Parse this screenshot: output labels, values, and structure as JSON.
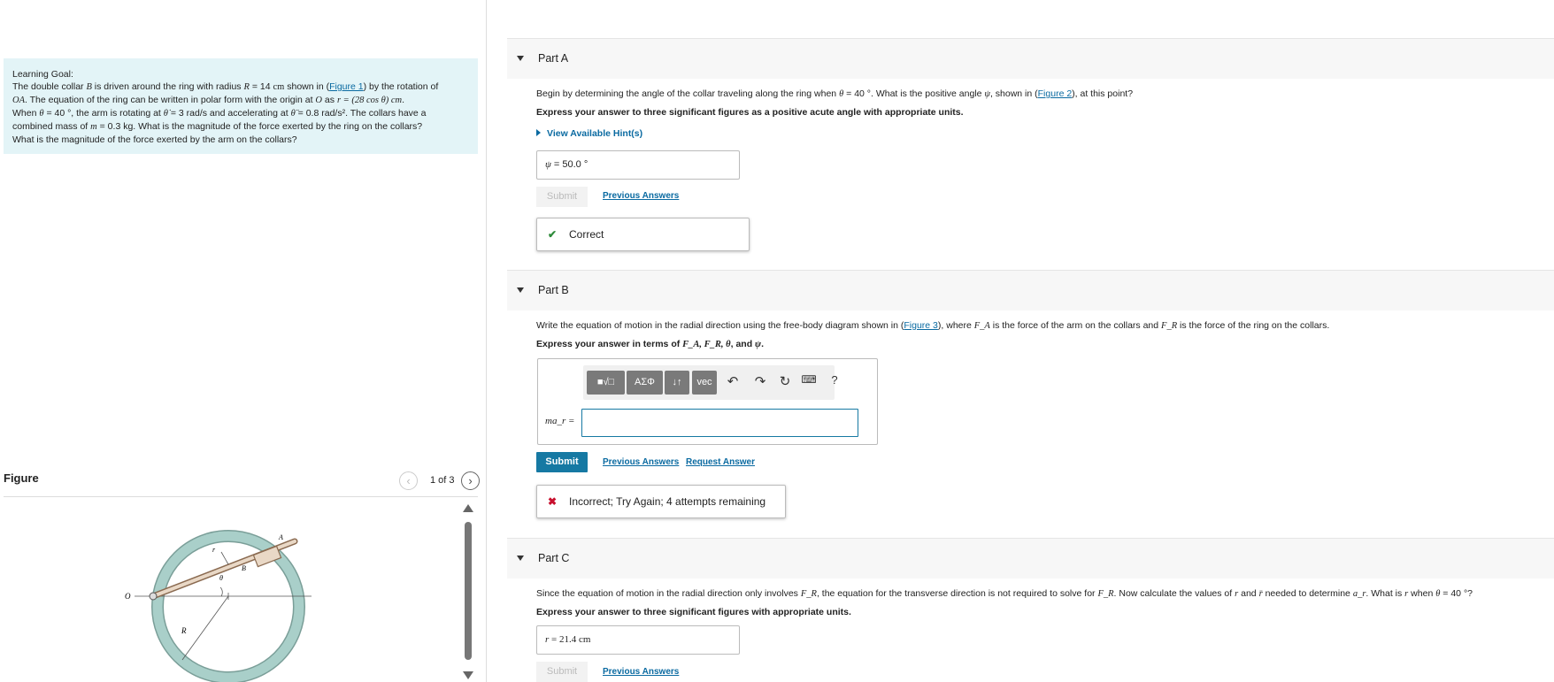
{
  "learning_goal": {
    "title": "Learning Goal:",
    "line1_a": "The double collar ",
    "line1_b": "B",
    "line1_c": " is driven around the ring with radius ",
    "line1_d": "R",
    "line1_e": " = 14 ",
    "line1_f": "cm",
    "line1_g": " shown in (",
    "line1_link": "Figure 1",
    "line1_h": ") by the rotation of",
    "line2_a": "OA",
    "line2_b": ". The equation of the ring can be written in polar form with the origin at ",
    "line2_c": "O",
    "line2_d": " as ",
    "line2_e": "r = (28 cos θ) cm",
    "line2_f": ".",
    "line3_a": "When ",
    "line3_b": "θ",
    "line3_c": " = 40 °, the arm is rotating at ",
    "line3_d": "θ̇",
    "line3_e": " = 3 rad/s and accelerating at ",
    "line3_f": "θ̈",
    "line3_g": " = 0.8 rad/s²",
    "line3_h": ". The collars have a",
    "line4_a": "combined mass of ",
    "line4_b": "m",
    "line4_c": " = 0.3 kg",
    "line4_d": ". What is the magnitude of the force exerted by the ring on the collars?",
    "line5": "What is the magnitude of the force exerted by the arm on the collars?"
  },
  "figure": {
    "title": "Figure",
    "counter": "1 of 3",
    "prev_icon": "chevron-left-icon",
    "next_icon": "chevron-right-icon",
    "labels": {
      "O": "O",
      "A": "A",
      "B": "B",
      "r": "r",
      "theta": "θ",
      "R": "R"
    }
  },
  "part_a": {
    "title": "Part A",
    "question_a": "Begin by determining the angle of the collar traveling along the ring when ",
    "question_b": "θ",
    "question_c": " = 40 °. What is the positive angle ",
    "question_d": "ψ",
    "question_e": ", shown in (",
    "question_link": "Figure 2",
    "question_f": "), at this point?",
    "instruction": "Express your answer to three significant figures as a positive acute angle with appropriate units.",
    "hint_label": "View Available Hint(s)",
    "answer_var": "ψ",
    "answer_value": " =  50.0 °",
    "submit_label": "Submit",
    "previous_answers": "Previous Answers",
    "feedback_mark": "✔",
    "feedback": "Correct"
  },
  "part_b": {
    "title": "Part B",
    "question_a": "Write the equation of motion in the radial direction using the free-body diagram shown in (",
    "question_link": "Figure 3",
    "question_b": "), where ",
    "question_c": "F_A",
    "question_d": " is the force of the arm on the collars and ",
    "question_e": "F_R",
    "question_f": " is the force of the ring on the collars.",
    "instruction_a": "Express your answer in terms of ",
    "instruction_b": "F_A, F_R, θ",
    "instruction_c": ", and ",
    "instruction_d": "ψ",
    "instruction_e": ".",
    "toolbar": {
      "template": "■√□",
      "greek": "ΑΣΦ",
      "arrows": "↓↑",
      "vec": "vec",
      "undo_icon": "undo-icon",
      "redo_icon": "redo-icon",
      "reset_icon": "reset-icon",
      "keyboard_icon": "keyboard-icon",
      "help": "?"
    },
    "input_label": "ma_r =",
    "input_value": "",
    "submit_label": "Submit",
    "previous_answers": "Previous Answers",
    "request_answer": "Request Answer",
    "feedback_mark": "✖",
    "feedback": "Incorrect; Try Again; 4 attempts remaining"
  },
  "part_c": {
    "title": "Part C",
    "question_a": "Since the equation of motion in the radial direction only involves ",
    "question_b": "F_R",
    "question_c": ", the equation for the transverse direction is not required to solve for ",
    "question_d": "F_R",
    "question_e": ". Now calculate the values of ",
    "question_f": "r",
    "question_g": " and ",
    "question_h": "r̈",
    "question_i": " needed to determine ",
    "question_j": "a_r",
    "question_k": ". What is ",
    "question_l": "r",
    "question_m": " when ",
    "question_n": "θ",
    "question_o": " = 40 °?",
    "instruction": "Express your answer to three significant figures with appropriate units.",
    "answer_var": "r",
    "answer_value": " =  21.4 cm",
    "submit_label": "Submit",
    "previous_answers": "Previous Answers"
  },
  "colors": {
    "learning_goal_bg": "#e3f4f7",
    "link": "#0a6aa1",
    "submit_bg": "#1679a3",
    "correct": "#2e8b3a",
    "incorrect": "#c8102e",
    "ring": "#a9cfc9"
  }
}
